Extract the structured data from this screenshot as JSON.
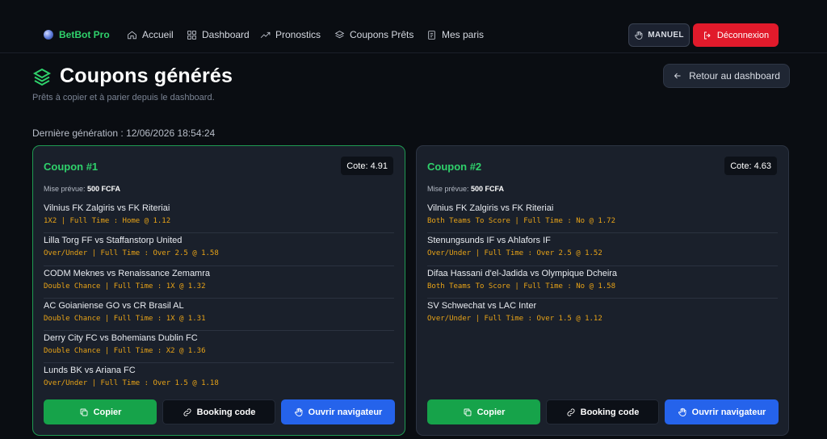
{
  "nav": {
    "brand": "BetBot Pro",
    "items": [
      {
        "label": "Accueil",
        "icon": "home-icon"
      },
      {
        "label": "Dashboard",
        "icon": "grid-icon"
      },
      {
        "label": "Pronostics",
        "icon": "trend-icon"
      },
      {
        "label": "Coupons Prêts",
        "icon": "layers-icon"
      },
      {
        "label": "Mes paris",
        "icon": "receipt-icon"
      }
    ],
    "manuel_label": "MANUEL",
    "logout_label": "Déconnexion"
  },
  "header": {
    "title": "Coupons générés",
    "subtitle": "Prêts à copier et à parier depuis le dashboard.",
    "back_label": "Retour au dashboard",
    "last_generation": "Dernière génération : 12/06/2026 18:54:24"
  },
  "mise_label": "Mise prévue:",
  "actions": {
    "copy": "Copier",
    "booking": "Booking code",
    "open": "Ouvrir navigateur"
  },
  "coupons": [
    {
      "title": "Coupon #1",
      "cote": "Cote: 4.91",
      "mise": "500 FCFA",
      "matches": [
        {
          "name": "Vilnius FK Zalgiris vs FK Riteriai",
          "bet": "1X2 | Full Time : Home @ 1.12"
        },
        {
          "name": "Lilla Torg FF vs Staffanstorp United",
          "bet": "Over/Under | Full Time : Over 2.5 @ 1.58"
        },
        {
          "name": "CODM Meknes vs Renaissance Zemamra",
          "bet": "Double Chance | Full Time : 1X @ 1.32"
        },
        {
          "name": "AC Goianiense GO vs CR Brasil AL",
          "bet": "Double Chance | Full Time : 1X @ 1.31"
        },
        {
          "name": "Derry City FC vs Bohemians Dublin FC",
          "bet": "Double Chance | Full Time : X2 @ 1.36"
        },
        {
          "name": "Lunds BK vs Ariana FC",
          "bet": "Over/Under | Full Time : Over 1.5 @ 1.18"
        }
      ]
    },
    {
      "title": "Coupon #2",
      "cote": "Cote: 4.63",
      "mise": "500 FCFA",
      "matches": [
        {
          "name": "Vilnius FK Zalgiris vs FK Riteriai",
          "bet": "Both Teams To Score | Full Time : No @ 1.72"
        },
        {
          "name": "Stenungsunds IF vs Ahlafors IF",
          "bet": "Over/Under | Full Time : Over 2.5 @ 1.52"
        },
        {
          "name": "Difaa Hassani d'el-Jadida vs Olympique Dcheira",
          "bet": "Both Teams To Score | Full Time : No @ 1.58"
        },
        {
          "name": "SV Schwechat vs LAC Inter",
          "bet": "Over/Under | Full Time : Over 1.5 @ 1.12"
        }
      ]
    }
  ],
  "colors": {
    "accent_green": "#2fd16b",
    "bet_orange": "#e8a317",
    "logout_red": "#e11a2b",
    "open_blue": "#2563eb"
  }
}
